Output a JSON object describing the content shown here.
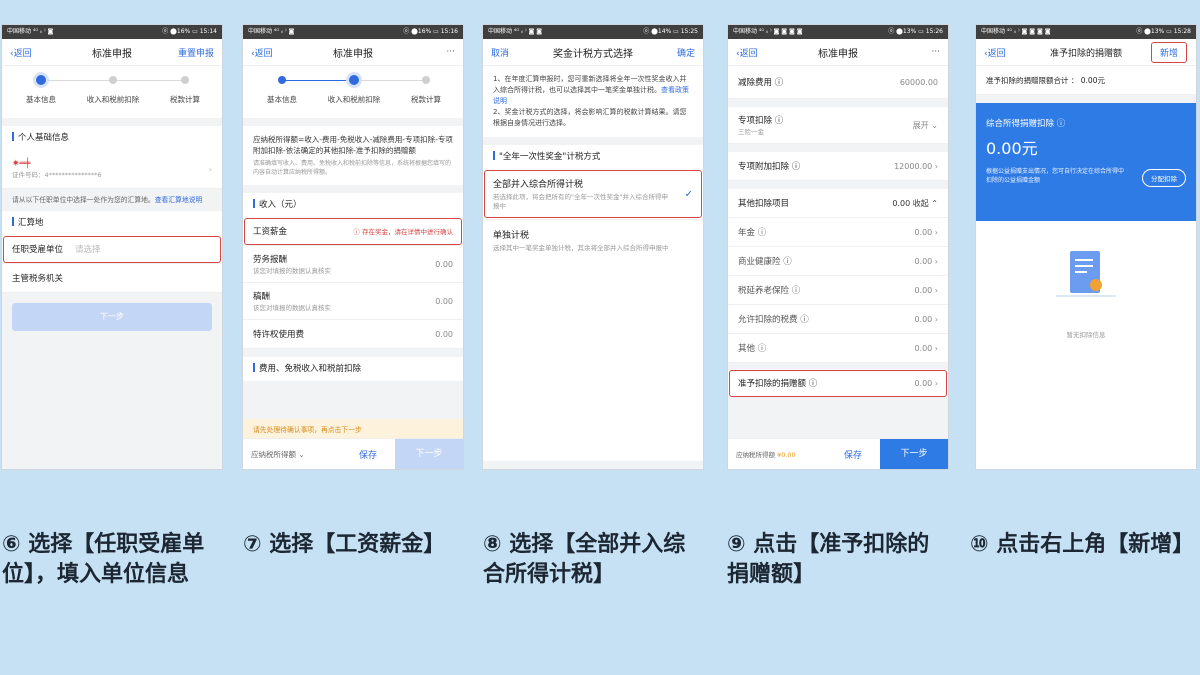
{
  "screens": [
    {
      "status": {
        "carrier": "中国移动 ⁴ᴳ ᵢₗ ⁾ ◙",
        "right": "ⓞ ⬤16% ▭ 15:14"
      },
      "nav": {
        "left": "返回",
        "title": "标准申报",
        "right": "重置申报"
      },
      "steps": [
        "基本信息",
        "收入和税前扣除",
        "税款计算"
      ],
      "section1": "个人基础信息",
      "name_mask": "✷═╪",
      "id_label": "证件号码：4***************6",
      "note": "请从以下任职单位中选择一处作为您的汇算地。",
      "note_link": "查看汇算地说明",
      "section2": "汇算地",
      "row1_label": "任职受雇单位",
      "row1_placeholder": "请选择",
      "row2_label": "主管税务机关",
      "next": "下一步"
    },
    {
      "status": {
        "carrier": "中国移动 ⁴ᴳ ᵢₗ ⁾ ◙",
        "right": "ⓞ ⬤16% ▭ 15:16"
      },
      "nav": {
        "left": "返回",
        "title": "标准申报",
        "right": "···"
      },
      "steps": [
        "基本信息",
        "收入和税前扣除",
        "税款计算"
      ],
      "formula": "应纳税所得额=收入-费用-免税收入-减除费用-专项扣除-专项附加扣除-依法确定的其他扣除-准予扣除的捐赠额",
      "formula_sub": "请准确填写收入、费用、免税收入和税前扣除等信息，系统将根据您填写的内容自动计算应纳税所得额。",
      "section": "收入（元）",
      "rows": [
        {
          "label": "工资薪金",
          "value": "",
          "warn": "ⓘ 存在奖金，请在详情中进行确认",
          "sub": ""
        },
        {
          "label": "劳务报酬",
          "value": "0.00",
          "warn": "",
          "sub": "该您对填报的数据认真核实"
        },
        {
          "label": "稿酬",
          "value": "0.00",
          "warn": "",
          "sub": "该您对填报的数据认真核实"
        },
        {
          "label": "特许权使用费",
          "value": "0.00",
          "warn": "",
          "sub": ""
        }
      ],
      "section2": "费用、免税收入和税前扣除",
      "warning": "请先处理待确认事项，再点击下一步",
      "bottom": {
        "a": "应纳税所得额 ⌄",
        "b": "保存",
        "c": "下一步"
      }
    },
    {
      "status": {
        "carrier": "中国移动 ⁴ᴳ ᵢₗ ⁾ ◙ ◙",
        "right": "ⓞ ⬤14% ▭ 15:25"
      },
      "nav": {
        "left": "取消",
        "title": "奖金计税方式选择",
        "right": "确定"
      },
      "notes": "1、在年度汇算申报时，您可重新选择将全年一次性奖金收入并入综合所得计税，也可以选择其中一笔奖金单独计税。",
      "notes_link": "查看政策说明",
      "notes2": "2、奖金计税方式的选择，将会影响汇算的税款计算结果。请您根据自身情况进行选择。",
      "section": "\"全年一次性奖金\"计税方式",
      "opt1_title": "全部并入综合所得计税",
      "opt1_desc": "若选择此项，将会把所有的\"全年一次性奖金\"并入综合所得申报中",
      "opt2_title": "单独计税",
      "opt2_desc": "选择其中一笔奖金单独计税，其余将全部并入综合所得申报中"
    },
    {
      "status": {
        "carrier": "中国移动 ⁴ᴳ ᵢₗ ⁾ ◙ ◙ ◙ ◙",
        "right": "ⓞ ⬤13% ▭ 15:26"
      },
      "nav": {
        "left": "返回",
        "title": "标准申报",
        "right": "···"
      },
      "rows_top": [
        {
          "label": "减除费用 ⓘ",
          "value": "60000.00"
        },
        {
          "label": "专项扣除 ⓘ",
          "value": "展开 ⌄",
          "sub": "三险一金"
        },
        {
          "label": "专项附加扣除 ⓘ",
          "value": "12000.00 ›"
        },
        {
          "label": "其他扣除项目",
          "value": "0.00 收起 ⌃"
        }
      ],
      "rows": [
        {
          "label": "年金 ⓘ",
          "value": "0.00 ›"
        },
        {
          "label": "商业健康险 ⓘ",
          "value": "0.00 ›"
        },
        {
          "label": "税延养老保险 ⓘ",
          "value": "0.00 ›"
        },
        {
          "label": "允许扣除的税费 ⓘ",
          "value": "0.00 ›"
        },
        {
          "label": "其他 ⓘ",
          "value": "0.00 ›"
        }
      ],
      "donation_label": "准予扣除的捐赠额 ⓘ",
      "donation_value": "0.00 ›",
      "bottom": {
        "a": "应纳税所得额",
        "amt": "¥0.00",
        "b": "保存",
        "c": "下一步"
      }
    },
    {
      "status": {
        "carrier": "中国移动 ⁴ᴳ ᵢₗ ⁾ ◙ ◙ ◙ ◙",
        "right": "ⓞ ⬤13% ▭ 15:28"
      },
      "nav": {
        "left": "返回",
        "title": "准予扣除的捐赠额",
        "right": "新增"
      },
      "total": "准予扣除的捐赠限额合计 ： 0.00元",
      "blue_title": "综合所得捐赠扣除 ⓘ",
      "blue_amount": "0.00元",
      "blue_desc": "根据公益捐赠支出情况，您可自行决定在综合所得中扣除的公益捐赠金额",
      "blue_btn": "分配扣除",
      "empty": "暂无扣除信息"
    }
  ],
  "captions": [
    "⑥ 选择【任职受雇单位】，填入单位信息",
    "⑦ 选择【工资薪金】",
    "⑧ 选择【全部并入综合所得计税】",
    "⑨ 点击【准予扣除的捐赠额】",
    "⑩ 点击右上角【新增】"
  ]
}
